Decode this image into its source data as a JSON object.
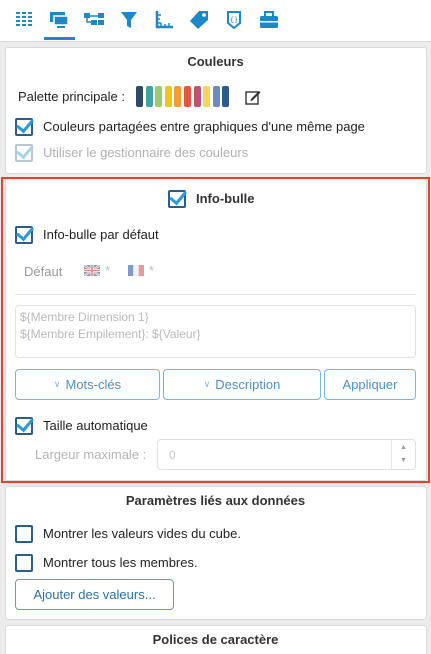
{
  "toolbar": {
    "icons": [
      "grid-icon",
      "monitor-icon",
      "hierarchy-icon",
      "filter-icon",
      "ruler-axis-icon",
      "tag-icon",
      "code-badge-icon",
      "toolbox-icon"
    ],
    "accent_color": "#1e88c7"
  },
  "couleurs": {
    "title": "Couleurs",
    "palette_label": "Palette principale :",
    "palette_colors": [
      "#2f4a66",
      "#3aa6a0",
      "#9ccc65",
      "#f0c419",
      "#f39c34",
      "#e8563f",
      "#c0546e",
      "#f6d55c",
      "#6c8ebf",
      "#2b5c8a"
    ],
    "shared_colors_label": "Couleurs partagées entre graphiques d'une même page",
    "shared_colors_checked": true,
    "color_manager_label": "Utiliser le gestionnaire des couleurs",
    "color_manager_checked": true
  },
  "infobulle": {
    "title": "Info-bulle",
    "enabled": true,
    "default_label": "Info-bulle par défaut",
    "default_checked": true,
    "tabs": [
      {
        "label": "Défaut",
        "active": true
      },
      {
        "label": "*",
        "flag": "uk"
      },
      {
        "label": "*",
        "flag": "fr"
      }
    ],
    "template_text": "${Membre Dimension 1}\n${Membre Empilement}: ${Valeur}",
    "buttons": {
      "keywords": "Mots-clés",
      "description": "Description",
      "apply": "Appliquer"
    },
    "auto_size_label": "Taille automatique",
    "auto_size_checked": true,
    "max_width_label": "Largeur maximale :",
    "max_width_value": "0"
  },
  "donnees": {
    "title": "Paramètres liés aux données",
    "show_empty_label": "Montrer les valeurs vides du cube.",
    "show_empty_checked": false,
    "show_all_label": "Montrer tous les membres.",
    "show_all_checked": false,
    "add_values_label": "Ajouter des valeurs..."
  },
  "polices": {
    "title": "Polices de caractère"
  },
  "highlight_color": "#e8431f"
}
